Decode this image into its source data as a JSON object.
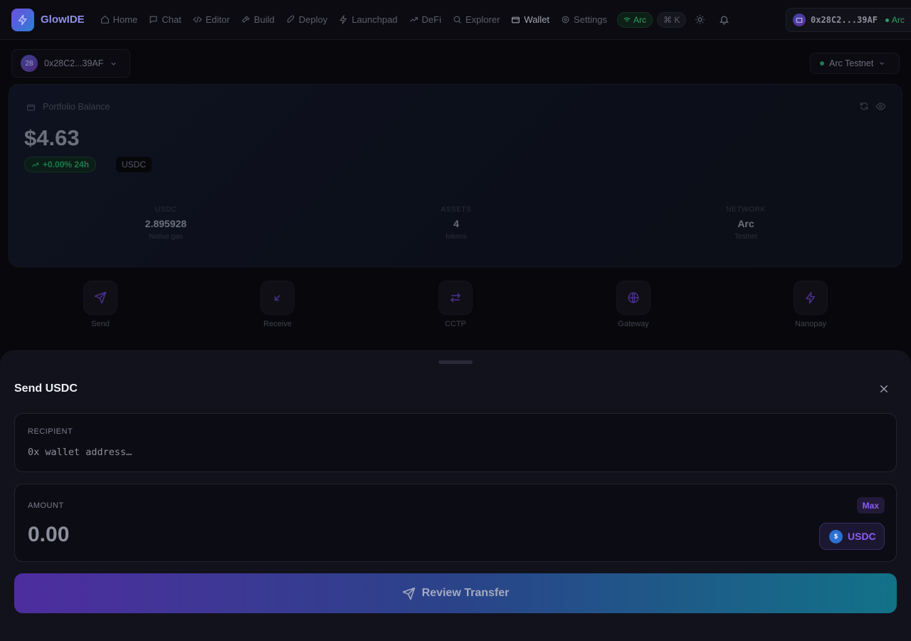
{
  "app": {
    "name": "GlowIDE"
  },
  "nav": {
    "items": [
      {
        "label": "Home",
        "icon": "home-icon"
      },
      {
        "label": "Chat",
        "icon": "chat-icon"
      },
      {
        "label": "Editor",
        "icon": "code-icon"
      },
      {
        "label": "Build",
        "icon": "hammer-icon"
      },
      {
        "label": "Deploy",
        "icon": "rocket-icon"
      },
      {
        "label": "Launchpad",
        "icon": "bolt-icon"
      },
      {
        "label": "DeFi",
        "icon": "trend-icon"
      },
      {
        "label": "Explorer",
        "icon": "search-icon"
      },
      {
        "label": "Wallet",
        "icon": "wallet-icon"
      },
      {
        "label": "Settings",
        "icon": "gear-icon"
      }
    ],
    "active": "Wallet",
    "network_pill": "Arc",
    "shortcut_pill": "⌘ K",
    "wallet_address": "0x28C2...39AF",
    "wallet_network": "Arc"
  },
  "account": {
    "avatar": "28",
    "address": "0x28C2...39AF"
  },
  "network_selector": {
    "label": "Arc Testnet"
  },
  "portfolio": {
    "title": "Portfolio Balance",
    "balance": "$4.63",
    "change": "+0.00% 24h",
    "currency_tag": "USDC",
    "stats": [
      {
        "key": "USDC",
        "value": "2.895928",
        "sub": "Native gas"
      },
      {
        "key": "ASSETS",
        "value": "4",
        "sub": "tokens"
      },
      {
        "key": "NETWORK",
        "value": "Arc",
        "sub": "Testnet"
      }
    ]
  },
  "actions": [
    {
      "label": "Send",
      "icon": "send-icon"
    },
    {
      "label": "Receive",
      "icon": "receive-icon"
    },
    {
      "label": "CCTP",
      "icon": "swap-icon"
    },
    {
      "label": "Gateway",
      "icon": "globe-icon"
    },
    {
      "label": "Nanopay",
      "icon": "bolt-icon"
    }
  ],
  "send_sheet": {
    "title": "Send USDC",
    "recipient_label": "RECIPIENT",
    "recipient_placeholder": "0x wallet address…",
    "amount_label": "AMOUNT",
    "amount_value": "0.00",
    "max_label": "Max",
    "token": "USDC",
    "token_symbol": "$",
    "submit_label": "Review Transfer"
  },
  "colors": {
    "accent": "#8b5cf6",
    "success": "#2f9e62",
    "button_gradient_start": "#4e2d9f",
    "button_gradient_end": "#127288"
  }
}
